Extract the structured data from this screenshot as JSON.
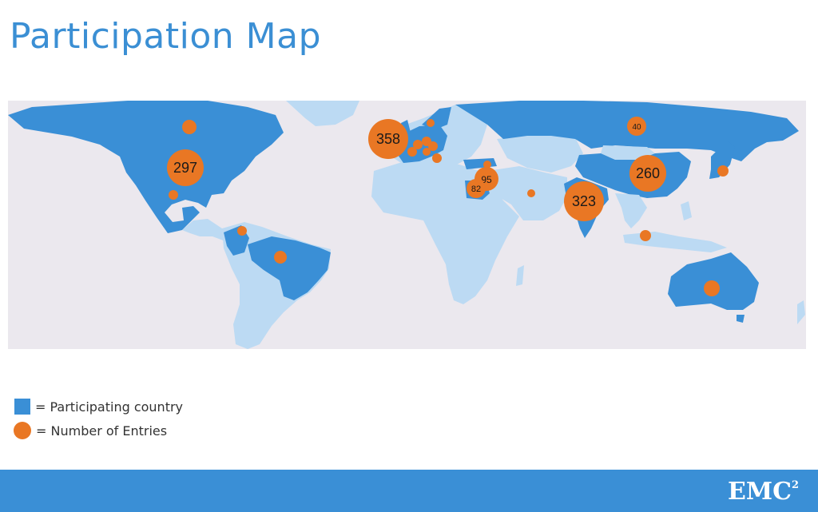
{
  "title": "Participation Map",
  "colors": {
    "participating": "#3a8fd6",
    "non_participating": "#bcdaf3",
    "marker": "#e97724",
    "ocean": "#ebe8ee",
    "brand": "#3a8fd6"
  },
  "markers": [
    {
      "label": "297"
    },
    {
      "label": "358"
    },
    {
      "label": "95"
    },
    {
      "label": "82"
    },
    {
      "label": "323"
    },
    {
      "label": "260"
    },
    {
      "label": "40"
    }
  ],
  "legend": {
    "participating": "= Participating country",
    "entries": "= Number of Entries"
  },
  "footer": {
    "logo": "EMC",
    "logo_sup": "2"
  }
}
